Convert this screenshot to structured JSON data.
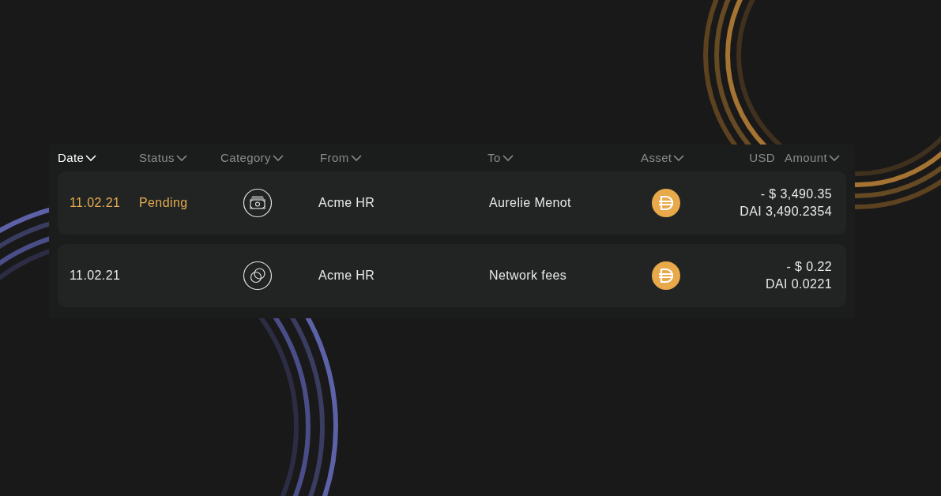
{
  "table": {
    "columns": [
      {
        "label": "Date",
        "selected": true
      },
      {
        "label": "Status",
        "selected": false
      },
      {
        "label": "Category",
        "selected": false
      },
      {
        "label": "From",
        "selected": false
      },
      {
        "label": "To",
        "selected": false
      },
      {
        "label": "Asset",
        "selected": false
      },
      {
        "label": "Amount",
        "unit": "USD",
        "selected": false
      }
    ],
    "rows": [
      {
        "date": "11.02.21",
        "pending": true,
        "status": "Pending",
        "category": {
          "kind": "cash"
        },
        "from": "Acme HR",
        "to": "Aurelie Menot",
        "asset": {
          "kind": "dai"
        },
        "usd": "- $ 3,490.35",
        "amount": "DAI 3,490.2354"
      },
      {
        "date": "11.02.21",
        "pending": false,
        "category": {
          "kind": "coins"
        },
        "from": "Acme HR",
        "to": "Network fees",
        "asset": {
          "kind": "dai"
        },
        "usd": "- $ 0.22",
        "amount": "DAI 0.0221"
      }
    ]
  }
}
